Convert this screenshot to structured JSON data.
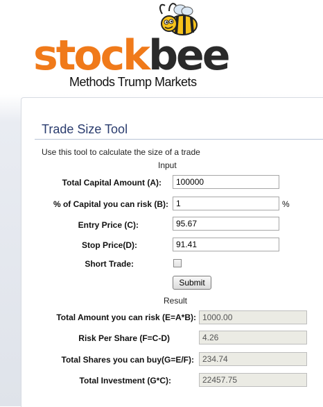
{
  "header": {
    "logo_part1": "stock",
    "logo_part2": "bee",
    "tagline": "Methods Trump Markets"
  },
  "tool": {
    "title": "Trade Size Tool",
    "intro": "Use this tool to calculate the size of a trade",
    "input_heading": "Input",
    "result_heading": "Result",
    "submit_label": "Submit"
  },
  "inputs": {
    "capital": {
      "label": "Total Capital Amount (A):",
      "value": "100000"
    },
    "risk": {
      "label": "% of Capital you can risk (B):",
      "value": "1",
      "unit": "%"
    },
    "entry": {
      "label": "Entry Price (C):",
      "value": "95.67"
    },
    "stop": {
      "label": "Stop Price(D):",
      "value": "91.41"
    },
    "short": {
      "label": "Short Trade:",
      "checked": false
    }
  },
  "results": {
    "risk_amount": {
      "label": "Total Amount you can risk (E=A*B):",
      "value": "1000.00"
    },
    "risk_per_share": {
      "label": "Risk Per Share (F=C-D)",
      "value": "4.26"
    },
    "shares": {
      "label": "Total Shares you can buy(G=E/F):",
      "value": "234.74"
    },
    "investment": {
      "label": "Total Investment (G*C):",
      "value": "22457.75"
    }
  },
  "colors": {
    "logo_orange": "#f07a1a",
    "logo_dark": "#2a2a2a",
    "bee_yellow": "#f6c21b",
    "title_blue": "#2a3c6e"
  }
}
